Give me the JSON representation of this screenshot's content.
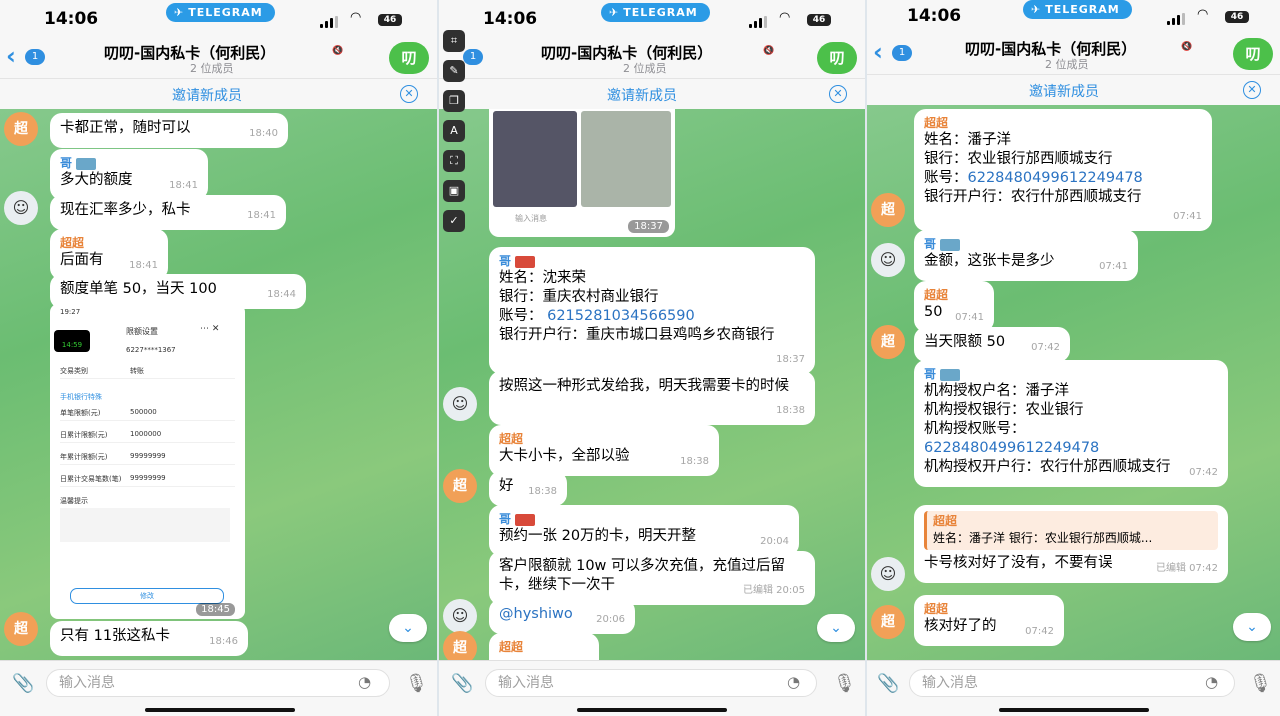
{
  "status": {
    "time": "14:06",
    "pill": "TELEGRAM",
    "battery": "46"
  },
  "header": {
    "title": "叨叨-国内私卡（何利民）",
    "members": "2 位成员",
    "avatar": "叨",
    "back_badge": "1"
  },
  "invite": {
    "label": "邀请新成员"
  },
  "input": {
    "placeholder": "输入消息"
  },
  "panel1": {
    "messages": [
      {
        "text": "卡都正常，随时可以",
        "time": "18:40"
      },
      {
        "sender": "哥",
        "text": "多大的额度",
        "time": "18:41"
      },
      {
        "text": "现在汇率多少，私卡",
        "time": "18:41"
      },
      {
        "sender": "超超",
        "text": "后面有",
        "time": "18:41"
      },
      {
        "text": "额度单笔 50，当天 100",
        "time": "18:44"
      },
      {
        "text": "只有 11张这私卡",
        "time": "18:46"
      }
    ],
    "screenshot": {
      "status_time": "19:27",
      "call_time": "14:59",
      "title": "限额设置",
      "card": "6227****1367",
      "type_label": "交易类别",
      "type_value": "转账",
      "section": "手机银行特殊",
      "rows": [
        {
          "label": "单笔限额(元)",
          "value": "500000"
        },
        {
          "label": "日累计限额(元)",
          "value": "1000000"
        },
        {
          "label": "年累计限额(元)",
          "value": "99999999"
        },
        {
          "label": "日累计交易笔数(笔)",
          "value": "99999999"
        }
      ],
      "hint": "温馨提示",
      "button": "修改",
      "time": "18:45"
    }
  },
  "panel2": {
    "photo_time": "18:37",
    "photo_caption": "输入消息",
    "card_msg": {
      "sender": "哥",
      "l1": "姓名：沈来荣",
      "l2": "银行：重庆农村商业银行",
      "l3_label": "账号：",
      "l3_value": "6215281034566590",
      "l4": "银行开户行：重庆市城口县鸡鸣乡农商银行",
      "time": "18:37"
    },
    "m2": {
      "text": "按照这一种形式发给我，明天我需要卡的时候",
      "time": "18:38"
    },
    "m3": {
      "sender": "超超",
      "text": "大卡小卡，全部以验",
      "time": "18:38"
    },
    "m4": {
      "text": "好",
      "time": "18:38"
    },
    "m5": {
      "sender": "哥",
      "text": "预约一张 20万的卡，明天开整",
      "time": "20:04"
    },
    "m6": {
      "text": "客户限额就 10w 可以多次充值，充值过后留卡，继续下一次干",
      "time": "20:05",
      "edited": "已编辑"
    },
    "m7": {
      "text": "@hyshiwo",
      "time": "20:06"
    },
    "m8": {
      "sender": "超超"
    },
    "avatar": "超"
  },
  "panel3": {
    "m1": {
      "sender": "超超",
      "l1": "姓名：潘子洋",
      "l2": "银行：农业银行邡西顺城支行",
      "l3_label": "账号：",
      "l3_value": "6228480499612249478",
      "l4": "银行开户行：农行什邡西顺城支行",
      "time": "07:41"
    },
    "m2": {
      "sender": "哥",
      "text": "金额，这张卡是多少",
      "time": "07:41"
    },
    "m3": {
      "sender": "超超",
      "text": "50",
      "time": "07:41"
    },
    "m4": {
      "text": "当天限额 50",
      "time": "07:42"
    },
    "m5": {
      "sender": "哥",
      "l1": "机构授权户名：潘子洋",
      "l2": "机构授权银行：农业银行",
      "l3": "机构授权账号：",
      "l4": "6228480499612249478",
      "l5": "机构授权开户行：农行什邡西顺城支行",
      "time": "07:42"
    },
    "m6": {
      "reply_sender": "超超",
      "reply_text": "姓名：潘子洋 银行：农业银行邡西顺城...",
      "text": "卡号核对好了没有，不要有误",
      "time": "07:42",
      "edited": "已编辑"
    },
    "m7": {
      "sender": "超超",
      "text": "核对好了的",
      "time": "07:42"
    },
    "avatar": "超"
  },
  "colors": {
    "accent": "#2f8fe0",
    "chat_bg": "#7cc47f",
    "orange_avatar": "#f1a057"
  }
}
